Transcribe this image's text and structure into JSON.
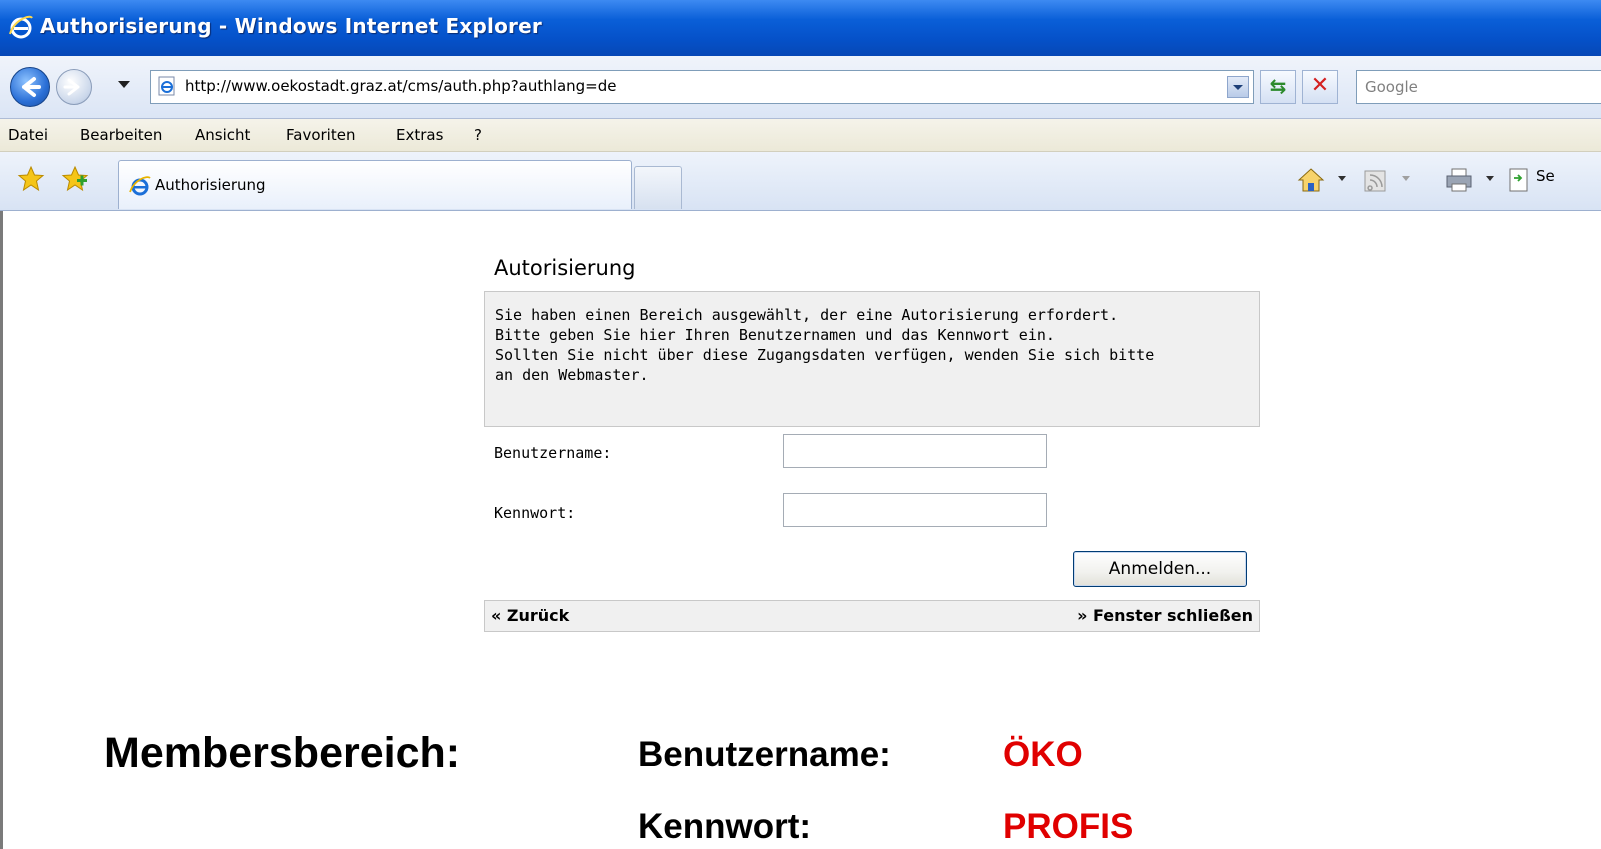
{
  "window": {
    "title": "Authorisierung - Windows Internet Explorer"
  },
  "addressbar": {
    "url": "http://www.oekostadt.graz.at/cms/auth.php?authlang=de",
    "search_placeholder": "Google"
  },
  "menu": {
    "items": [
      "Datei",
      "Bearbeiten",
      "Ansicht",
      "Favoriten",
      "Extras",
      "?"
    ]
  },
  "tabs": {
    "active_label": "Authorisierung",
    "command_partial": "Se"
  },
  "auth": {
    "heading": "Autorisierung",
    "info_text": "Sie haben einen Bereich ausgewählt, der eine Autorisierung erfordert.\nBitte geben Sie hier Ihren Benutzernamen und das Kennwort ein.\nSollten Sie nicht über diese Zugangsdaten verfügen, wenden Sie sich bitte\nan den Webmaster.",
    "username_label": "Benutzername:",
    "password_label": "Kennwort:",
    "username_value": "",
    "password_value": "",
    "login_button": "Anmelden...",
    "back_link": "« Zurück",
    "close_link": "» Fenster schließen"
  },
  "credentials": {
    "section_title": "Membersbereich:",
    "username_label": "Benutzername:",
    "username_value": "ÖKO",
    "password_label": "Kennwort:",
    "password_value": "PROFIS"
  },
  "colors": {
    "titlebar": "#0551c9",
    "credential_value": "#e00000"
  }
}
